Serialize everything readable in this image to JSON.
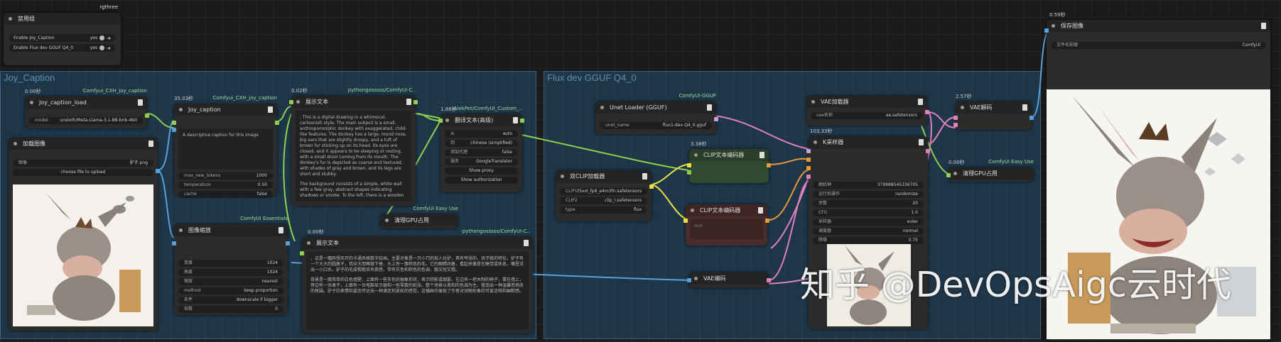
{
  "groups": {
    "joy": "Joy_Caption",
    "flux": "Flux dev GGUF Q4_0"
  },
  "bypass_node": {
    "badge": "rgthree",
    "title": "禁用组",
    "rows": [
      {
        "label": "Enable Joy_Caption",
        "value": "yes"
      },
      {
        "label": "Enable Flux dev GGUF Q4_0",
        "value": "yes"
      }
    ]
  },
  "joy_load": {
    "timing": "0.00秒",
    "badge": "Comfyui_CXH_joy_caption",
    "title": "Joy_caption_load",
    "model_label": "model",
    "model_value": "unsloth/Meta-Llama-3.1-8B-bnb-4bit"
  },
  "load_image": {
    "title": "加载图像",
    "image_label": "图像",
    "image_value": "驴子.png",
    "upload": "choose file to upload"
  },
  "joy_caption": {
    "timing": "35.03秒",
    "badge": "Comfyui_CXH_joy_caption",
    "title": "Joy_caption",
    "prompt": "A descriptive caption for this image",
    "w": [
      {
        "label": "max_new_tokens",
        "value": "1000"
      },
      {
        "label": "temperature",
        "value": "0.50"
      },
      {
        "label": "cache",
        "value": "false"
      }
    ]
  },
  "show_text_1": {
    "timing": "0.02秒",
    "badge": "pythongosssss/ComfyUI-C..",
    "title": "展示文本",
    "p1": ". This is a digital drawing in a whimsical, cartoonish style. The main subject is a small, anthropomorphic donkey with exaggerated, child-like features. The donkey has a large, round nose, big ears that are slightly droopy, and a tuft of brown fur sticking up on its head. Its eyes are closed, and it appears to be sleeping or resting, with a small drool coming from its mouth. The donkey's fur is depicted as coarse and textured, with shades of gray and brown, and its legs are short and stubby.",
    "p2": "The background consists of a simple, white wall with a few gray, abstract shapes indicating shadows or smoke. To the left, there is a wooden"
  },
  "translate": {
    "timing": "1.88秒",
    "badge": "AlekPet/ComfyUI_Custom_..",
    "title": "翻译文本(高级)",
    "w": [
      {
        "label": "从",
        "value": "auto"
      },
      {
        "label": "到",
        "value": "chinese (simplified)"
      },
      {
        "label": "添加代理",
        "value": "false"
      },
      {
        "label": "服务",
        "value": "GoogleTranslator"
      }
    ],
    "b1": "Show proxy",
    "b2": "Show authorization"
  },
  "image_scale": {
    "badge": "ComfyUI Essentials",
    "title": "图像缩放",
    "w": [
      {
        "label": "宽度",
        "value": "1024"
      },
      {
        "label": "高度",
        "value": "1024"
      },
      {
        "label": "缩放",
        "value": "nearest"
      },
      {
        "label": "method",
        "value": "keep proportion"
      },
      {
        "label": "条件",
        "value": "downscale if bigger"
      },
      {
        "label": "倍数",
        "value": "0"
      }
    ]
  },
  "clear_gpu_1": {
    "badge": "ComfyUI Easy Use",
    "title": "清理GPU占用"
  },
  "show_text_2": {
    "timing": "0.00秒",
    "badge": "pythongosssss/ComfyUI-C..",
    "title": "展示文本",
    "p1": "，这是一幅异想天开的卡通风格数字绘画。主要对象是一只小巧的拟人化驴，具有夸张的、孩子般的特征。驴子有一个大大的圆鼻子，耳朵大而略微下垂，头上有一簇棕色的毛。它的眼睛闭着，看起来像是在睡觉或休息，嘴里流出一小口水。驴子的毛皮粗糙且有质感，带有灰色和棕色的色调，腿又短又粗。",
    "p2": "背景是一面简单的白色墙壁，上面有一些灰色的抽象形状，表示阴影或烟雾。左边有一把木制的椅子，靠在墙上，旁边有一张桌子，上面有一台电脑显示器和一些零散的纸张。整个场景以柔和的色调为主，营造出一种温馨而俏皮的氛围。驴子的表情和姿态传达出一种满足和放松的感觉，这幅画作展现了作者对动物形象的可爱诠释和幽默感。"
  },
  "unet": {
    "badge": "ComfyUI-GGUF",
    "title": "Unet Loader (GGUF)",
    "label": "unet_name",
    "value": "flux1-dev-Q4_0.gguf"
  },
  "dual_clip": {
    "title": "双CLIP加载器",
    "w": [
      {
        "label": "CLIP1",
        "value": "t5xxl_fp8_e4m3fn.safetensors"
      },
      {
        "label": "CLIP2",
        "value": "clip_l.safetensors"
      },
      {
        "label": "type",
        "value": "flux"
      }
    ]
  },
  "clip_pos": {
    "timing": "3.38秒",
    "title": "CLIP文本编码器"
  },
  "clip_neg": {
    "title": "CLIP文本编码器",
    "placeholder": "text"
  },
  "vae_encode": {
    "title": "VAE编码"
  },
  "vae_loader": {
    "title": "VAE加载器",
    "label": "vae名称",
    "value": "ae.safetensors"
  },
  "ksampler": {
    "timing": "103.33秒",
    "title": "K采样器",
    "w": [
      {
        "label": "随机种",
        "value": "379988545336705"
      },
      {
        "label": "运行后操作",
        "value": "randomize"
      },
      {
        "label": "步数",
        "value": "20"
      },
      {
        "label": "CFG",
        "value": "1.0"
      },
      {
        "label": "采样器",
        "value": "euler"
      },
      {
        "label": "调度器",
        "value": "normal"
      },
      {
        "label": "降噪",
        "value": "0.75"
      }
    ]
  },
  "vae_decode": {
    "timing": "2.57秒",
    "title": "VAE解码"
  },
  "clear_gpu_2": {
    "timing": "0.00秒",
    "badge": "ComfyUI Easy Use",
    "title": "清理GPU占用"
  },
  "save_image": {
    "timing": "0.59秒",
    "title": "保存图像",
    "label": "文件名前缀",
    "value": "ComfyUI"
  },
  "watermark": "知乎 @DevOpsAigc云时代",
  "colors": {
    "group": "#2a6a98",
    "clip_pos": "#2f4a2f",
    "clip_neg": "#4a2c2c",
    "wire_yellow": "#e8e04a",
    "wire_green": "#8fd14f",
    "wire_blue": "#5aa0d8",
    "wire_pink": "#e080c0",
    "wire_orange": "#e89a3a"
  }
}
